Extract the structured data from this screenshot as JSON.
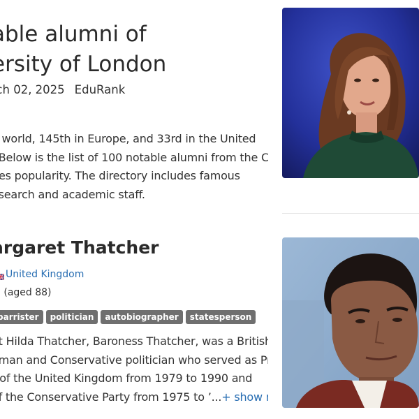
{
  "article": {
    "title_line1": "able alumni of",
    "title_line2": "ersity of London",
    "date": "rch 02, 2025",
    "author": "EduRank",
    "intro_lines": [
      "e world, 145th in Europe, and 33rd in the United",
      ". Below is the list of 100 notable alumni from the Ci",
      "ges popularity. The directory includes famous",
      "esearch and academic staff."
    ]
  },
  "person": {
    "name": "argaret Thatcher",
    "country": "United Kingdom",
    "lifespan": "3 (aged 88)",
    "tags": [
      "barrister",
      "politician",
      "autobiographer",
      "statesperson"
    ],
    "bio_lines": [
      "et Hilda Thatcher, Baroness Thatcher, was a British",
      "oman and Conservative politician who served as Pr",
      "r of the United Kingdom from 1979 to 1990 and",
      "of the Conservative Party from 1975 to ’..."
    ],
    "show_more": "+ show m"
  }
}
